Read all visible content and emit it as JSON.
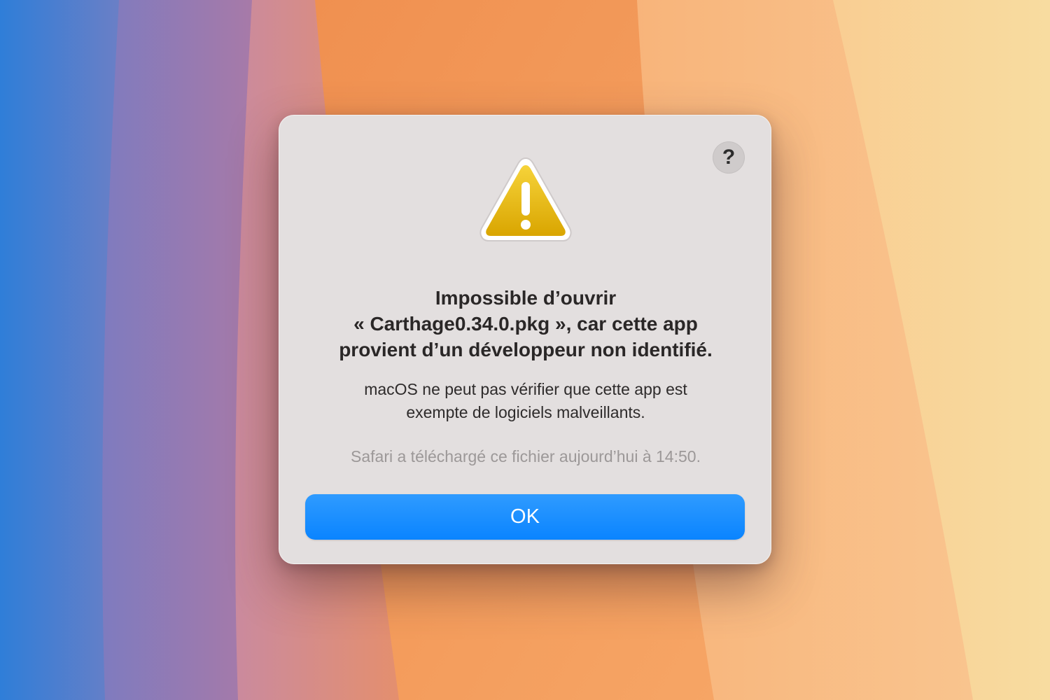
{
  "dialog": {
    "title": "Impossible d’ouvrir\n« Carthage0.34.0.pkg », car cette app\nprovient d’un développeur non identifié.",
    "message": "macOS ne peut pas vérifier que cette app est\nexempte de logiciels malveillants.",
    "download_note": "Safari a téléchargé ce fichier aujourd’hui à 14:50.",
    "ok_label": "OK",
    "help_label": "?",
    "icon": "warning-triangle-icon"
  },
  "colors": {
    "dialog_background": "#e3dfdf",
    "accent_button": "#0a84ff",
    "warning_yellow": "#e8b80c"
  }
}
